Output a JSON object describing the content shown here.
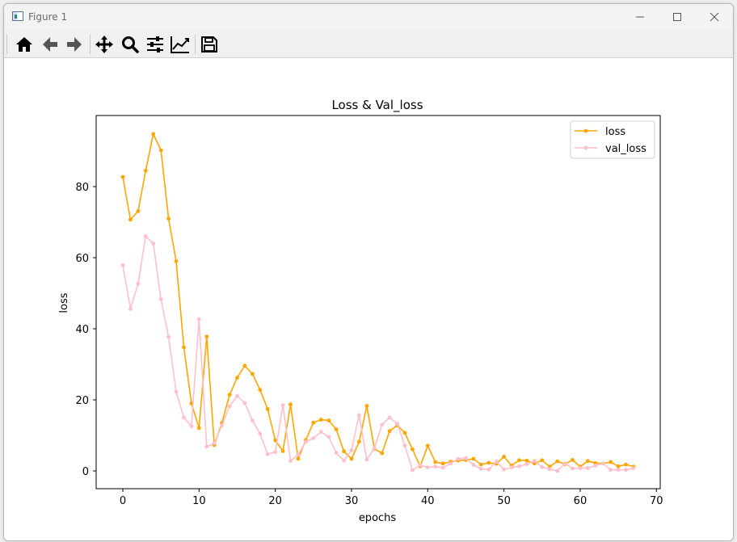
{
  "window": {
    "title": "Figure 1"
  },
  "toolbar": {
    "buttons": [
      {
        "name": "home-icon"
      },
      {
        "name": "back-icon"
      },
      {
        "name": "forward-icon"
      },
      {
        "name": "pan-icon"
      },
      {
        "name": "zoom-icon"
      },
      {
        "name": "configure-subplots-icon"
      },
      {
        "name": "edit-axis-icon"
      },
      {
        "name": "save-icon"
      }
    ]
  },
  "chart_data": {
    "type": "line",
    "title": "Loss & Val_loss",
    "xlabel": "epochs",
    "ylabel": "loss",
    "xlim": [
      -3.5,
      70.5
    ],
    "ylim": [
      -5,
      100
    ],
    "xticks": [
      0,
      10,
      20,
      30,
      40,
      50,
      60,
      70
    ],
    "yticks": [
      0,
      20,
      40,
      60,
      80
    ],
    "grid": false,
    "legend_position": "top-right",
    "x": [
      0,
      1,
      2,
      3,
      4,
      5,
      6,
      7,
      8,
      9,
      10,
      11,
      12,
      13,
      14,
      15,
      16,
      17,
      18,
      19,
      20,
      21,
      22,
      23,
      24,
      25,
      26,
      27,
      28,
      29,
      30,
      31,
      32,
      33,
      34,
      35,
      36,
      37,
      38,
      39,
      40,
      41,
      42,
      43,
      44,
      45,
      46,
      47,
      48,
      49,
      50,
      51,
      52,
      53,
      54,
      55,
      56,
      57,
      58,
      59,
      60,
      61,
      62,
      63,
      64,
      65,
      66,
      67
    ],
    "series": [
      {
        "name": "loss",
        "color": "#ffa500",
        "values": [
          82.7,
          70.7,
          73.1,
          84.5,
          94.8,
          90.2,
          71.0,
          59.0,
          34.8,
          19.0,
          12.1,
          37.8,
          7.3,
          13.5,
          21.4,
          26.2,
          29.6,
          27.3,
          22.8,
          17.4,
          8.6,
          5.6,
          18.7,
          3.4,
          8.7,
          13.6,
          14.4,
          14.2,
          11.7,
          5.5,
          3.4,
          8.2,
          18.3,
          6.2,
          5.0,
          11.2,
          12.8,
          10.7,
          6.1,
          1.3,
          7.1,
          2.5,
          2.1,
          2.6,
          2.9,
          3.1,
          3.4,
          1.8,
          2.3,
          2.0,
          4.0,
          1.5,
          3.0,
          2.9,
          2.1,
          3.0,
          1.2,
          2.7,
          1.9,
          3.1,
          1.2,
          2.8,
          2.2,
          2.1,
          2.5,
          1.3,
          1.8,
          1.2
        ]
      },
      {
        "name": "val_loss",
        "color": "#ffc0cb",
        "values": [
          57.9,
          45.6,
          52.7,
          66.0,
          64.0,
          48.3,
          37.7,
          22.3,
          15.0,
          12.6,
          42.7,
          6.8,
          7.8,
          12.8,
          18.2,
          21.1,
          19.1,
          14.2,
          10.4,
          4.7,
          5.3,
          18.5,
          2.8,
          4.6,
          8.2,
          9.2,
          11.0,
          9.6,
          5.1,
          2.9,
          5.8,
          15.7,
          3.2,
          6.4,
          13.0,
          15.0,
          13.3,
          7.1,
          0.2,
          1.6,
          1.0,
          1.2,
          0.9,
          2.1,
          3.4,
          3.6,
          1.7,
          0.6,
          0.4,
          2.6,
          0.4,
          1.0,
          1.3,
          1.9,
          2.8,
          1.1,
          0.5,
          0.0,
          2.1,
          0.7,
          0.8,
          0.8,
          1.5,
          2.1,
          0.3,
          0.3,
          0.3,
          0.8
        ]
      }
    ]
  }
}
